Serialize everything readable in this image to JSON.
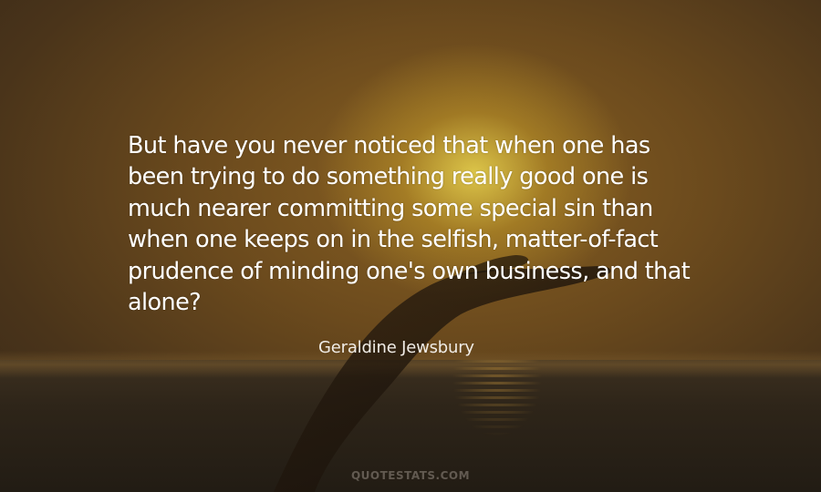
{
  "quote": {
    "lines": [
      "But have you never noticed that when one has",
      "been trying to do something really good one is",
      "much nearer committing some special sin than",
      "when one keeps on in the selfish, matter-of-fact",
      "prudence of minding one's own business, and that",
      "alone?"
    ],
    "author": "Geraldine Jewsbury"
  },
  "watermark": "QUOTESTATS.COM"
}
